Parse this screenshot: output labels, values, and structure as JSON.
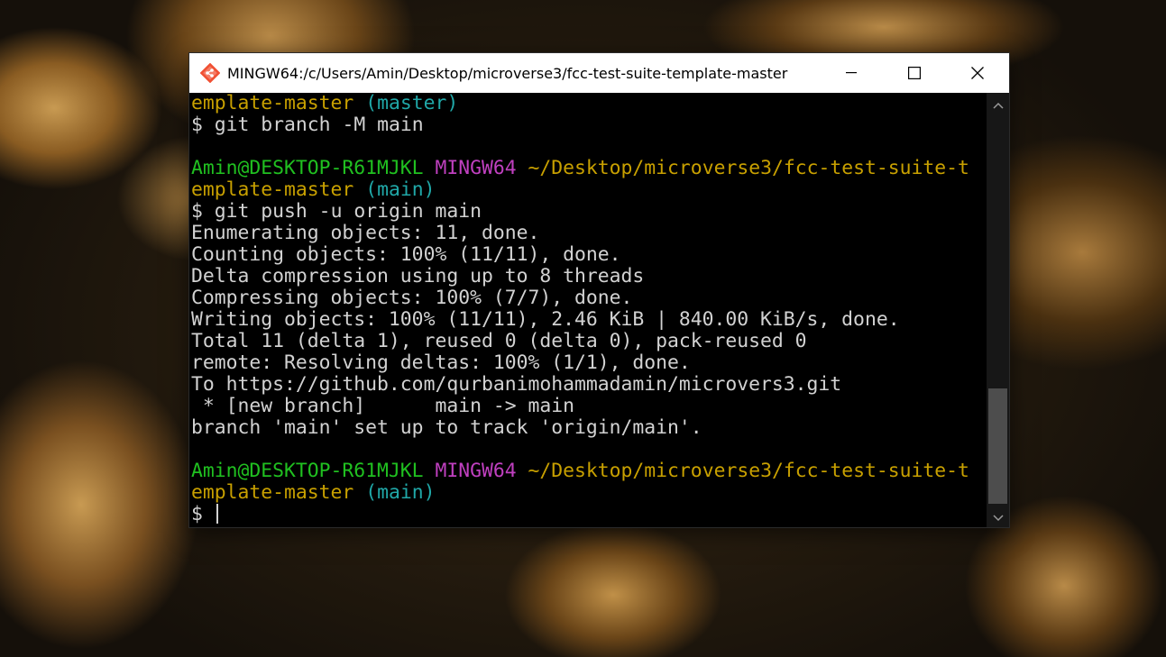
{
  "window": {
    "title": "MINGW64:/c/Users/Amin/Desktop/microverse3/fcc-test-suite-template-master",
    "icon": "git-bash-icon",
    "controls": {
      "minimize": "minimize-icon",
      "maximize": "maximize-icon",
      "close": "close-icon"
    }
  },
  "colors": {
    "user_host": "#20c020",
    "shell": "#c040c0",
    "path": "#c8a000",
    "branch": "#20a8a8",
    "text": "#d2d2d2",
    "background": "#000000"
  },
  "terminal": {
    "line1": {
      "path": "emplate-master",
      "branch": "(master)"
    },
    "line2": {
      "prompt": "$",
      "command": "git branch -M main"
    },
    "line4": {
      "user": "Amin@DESKTOP-R61MJKL",
      "shell": "MINGW64",
      "path": "~/Desktop/microverse3/fcc-test-suite-t"
    },
    "line5": {
      "path": "emplate-master",
      "branch": "(main)"
    },
    "line6": {
      "prompt": "$",
      "command": "git push -u origin main"
    },
    "output": [
      "Enumerating objects: 11, done.",
      "Counting objects: 100% (11/11), done.",
      "Delta compression using up to 8 threads",
      "Compressing objects: 100% (7/7), done.",
      "Writing objects: 100% (11/11), 2.46 KiB | 840.00 KiB/s, done.",
      "Total 11 (delta 1), reused 0 (delta 0), pack-reused 0",
      "remote: Resolving deltas: 100% (1/1), done.",
      "To https://github.com/qurbanimohammadamin/microvers3.git",
      " * [new branch]      main -> main",
      "branch 'main' set up to track 'origin/main'."
    ],
    "line18": {
      "user": "Amin@DESKTOP-R61MJKL",
      "shell": "MINGW64",
      "path": "~/Desktop/microverse3/fcc-test-suite-t"
    },
    "line19": {
      "path": "emplate-master",
      "branch": "(main)"
    },
    "line20": {
      "prompt": "$"
    }
  }
}
